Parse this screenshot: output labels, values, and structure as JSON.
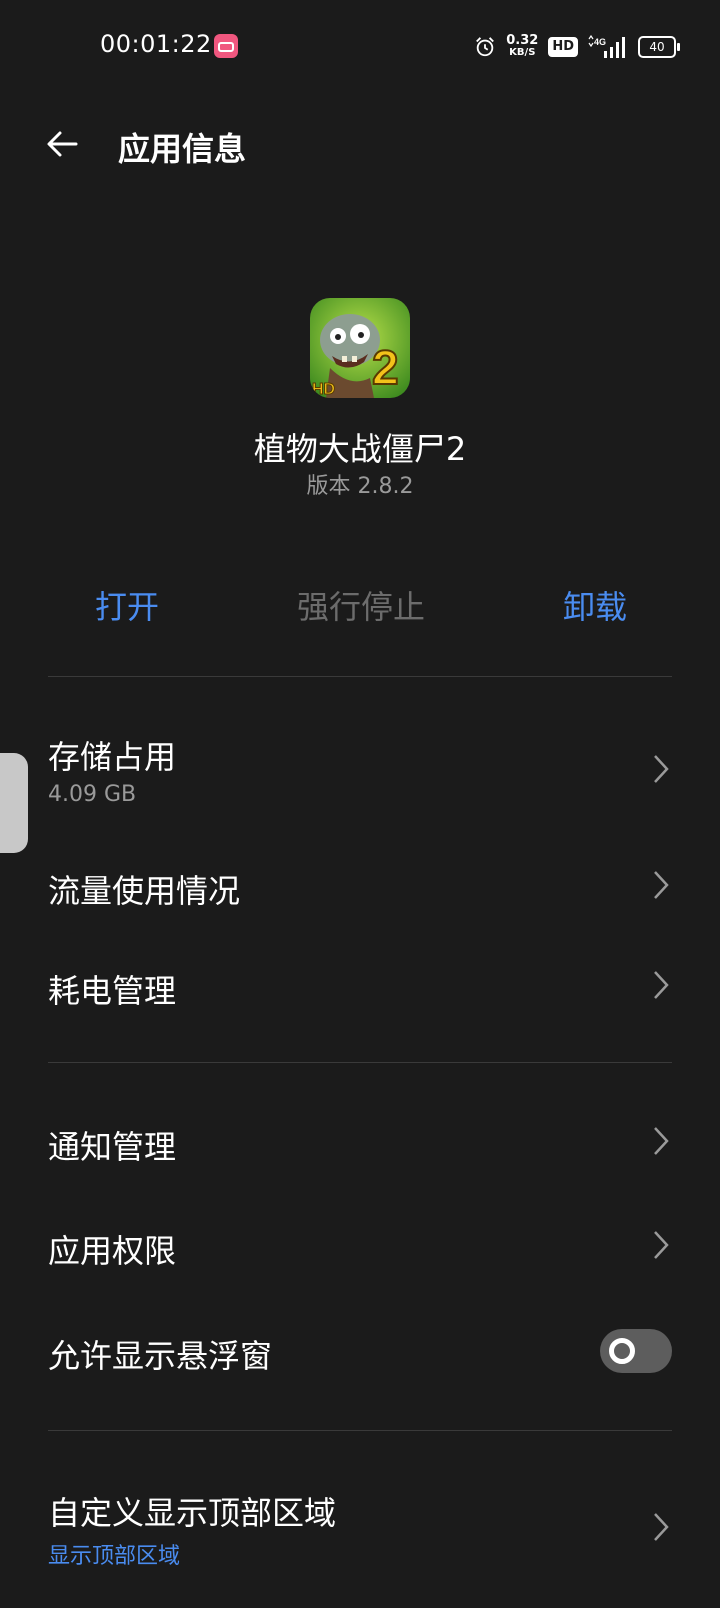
{
  "status_bar": {
    "time": "00:01:22",
    "net_speed": "0.32",
    "net_speed_unit": "KB/S",
    "hd_label": "HD",
    "network_label": "4G",
    "battery": "40"
  },
  "app_bar": {
    "title": "应用信息",
    "back_icon": "arrow-left-icon"
  },
  "app": {
    "name": "植物大战僵尸2",
    "version": "版本 2.8.2",
    "icon_badge": "HD",
    "icon_number": "2"
  },
  "actions": {
    "open": "打开",
    "force_stop": "强行停止",
    "uninstall": "卸载"
  },
  "sections": {
    "storage": {
      "title": "存储占用",
      "value": "4.09 GB"
    },
    "data_usage": {
      "title": "流量使用情况"
    },
    "battery": {
      "title": "耗电管理"
    },
    "notifications": {
      "title": "通知管理"
    },
    "permissions": {
      "title": "应用权限"
    },
    "floating_window": {
      "title": "允许显示悬浮窗",
      "enabled": false
    },
    "top_area": {
      "title": "自定义显示顶部区域",
      "value": "显示顶部区域"
    }
  },
  "colors": {
    "background": "#1b1b1b",
    "accent": "#4a8cf0",
    "secondary_text": "#9a9a9a",
    "disabled_text": "#6c6c6c"
  }
}
